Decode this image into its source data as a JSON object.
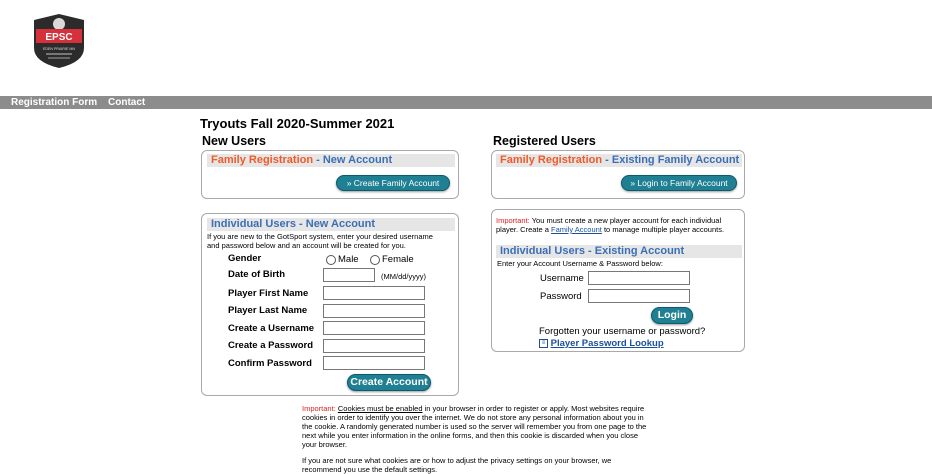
{
  "logo": {
    "text": "EPSC",
    "subtext": "EDEN PRAIRIE MN"
  },
  "nav": {
    "registration_form": "Registration Form",
    "contact": "Contact"
  },
  "page_title": "Tryouts Fall 2020-Summer 2021",
  "new_users": {
    "heading": "New Users",
    "family_bar": {
      "orange": "Family Registration",
      "sep": " - ",
      "blue": "New Account"
    },
    "create_family_button": "» Create Family Account",
    "individual_bar": {
      "blue": "Individual Users - New Account"
    },
    "individual_intro": "If you are new to the GotSport system, enter your desired username and password below and an account will be created for you.",
    "gender_label": "Gender",
    "male_label": "Male",
    "female_label": "Female",
    "dob_label": "Date of Birth",
    "dob_hint": "(MM/dd/yyyy)",
    "first_name_label": "Player First Name",
    "last_name_label": "Player Last Name",
    "username_label": "Create a Username",
    "password_label": "Create a Password",
    "confirm_label": "Confirm Password",
    "create_account_button": "Create Account"
  },
  "registered_users": {
    "heading": "Registered Users",
    "family_bar": {
      "orange": "Family Registration",
      "sep": " - ",
      "blue": "Existing Family Account"
    },
    "login_family_button": "» Login to Family Account",
    "important_label": "Important:",
    "important_text_1": " You must create a new player account for each individual player. Create a ",
    "family_account_link": "Family Account",
    "important_text_2": " to manage multiple player accounts.",
    "individual_bar": {
      "blue": "Individual Users - Existing Account"
    },
    "enter_text": "Enter your Account Username & Password below:",
    "username_label": "Username",
    "password_label": "Password",
    "login_button": "Login",
    "forgot_text": "Forgotten your username or password?",
    "lookup_link": "Player Password Lookup"
  },
  "footer": {
    "important_label": "Important:",
    "cookies_link": "Cookies must be enabled",
    "para1": " in your browser in order to register or apply. Most websites require cookies in order to identify you over the internet. We do not store any personal information about you in the cookie. A randomly generated number is used so the server will remember you from one page to the next while you enter information in the online forms, and then this cookie is discarded when you close your browser.",
    "para2": "If you are not sure what cookies are or how to adjust the privacy settings on your browser, we recommend you use the default settings."
  }
}
